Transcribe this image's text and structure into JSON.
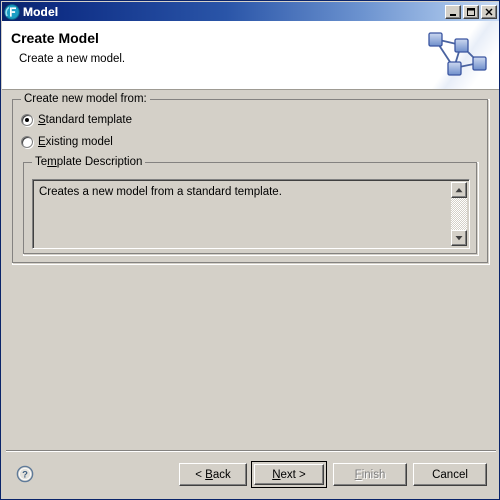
{
  "window": {
    "title": "Model",
    "icon": "app-model-icon",
    "controls": [
      {
        "name": "minimize-button",
        "glyph": "_"
      },
      {
        "name": "maximize-button",
        "glyph": "□"
      },
      {
        "name": "close-button",
        "glyph": "✕"
      }
    ]
  },
  "header": {
    "title": "Create Model",
    "subtitle": "Create a new model.",
    "banner_icon": "graph-network-icon"
  },
  "form": {
    "source_group": {
      "legend": "Create new model from:",
      "options": [
        {
          "label": "Standard template",
          "mnemonic": "S",
          "selected": true
        },
        {
          "label": "Existing model",
          "mnemonic": "E",
          "selected": false
        }
      ]
    },
    "description_group": {
      "legend": "Template Description",
      "legend_prefix": "Te",
      "legend_mnemonic": "m",
      "legend_suffix": "plate Description",
      "text": "Creates a new model from a standard template.",
      "scrollbar": {
        "up_arrow": "scroll-up-arrow",
        "down_arrow": "scroll-down-arrow"
      }
    }
  },
  "footer": {
    "help_icon": "help-question-icon",
    "buttons": [
      {
        "name": "back-button",
        "label": "< Back",
        "prefix": "< ",
        "mnemonic": "B",
        "suffix": "ack",
        "enabled": true,
        "default": false
      },
      {
        "name": "next-button",
        "label": "Next >",
        "prefix": "",
        "mnemonic": "N",
        "suffix": "ext >",
        "enabled": true,
        "default": true
      },
      {
        "name": "finish-button",
        "label": "Finish",
        "prefix": "",
        "mnemonic": "F",
        "suffix": "inish",
        "enabled": false,
        "default": false
      },
      {
        "name": "cancel-button",
        "label": "Cancel",
        "prefix": "",
        "mnemonic": "",
        "suffix": "",
        "enabled": true,
        "default": false
      }
    ]
  },
  "colors": {
    "dialog_face": "#d4d0c8",
    "title_start": "#0a246a",
    "title_end": "#c8daf4",
    "header_background": "#ffffff",
    "text": "#000000",
    "disabled_text": "#808080",
    "node_blue": "#5b7fc4"
  }
}
